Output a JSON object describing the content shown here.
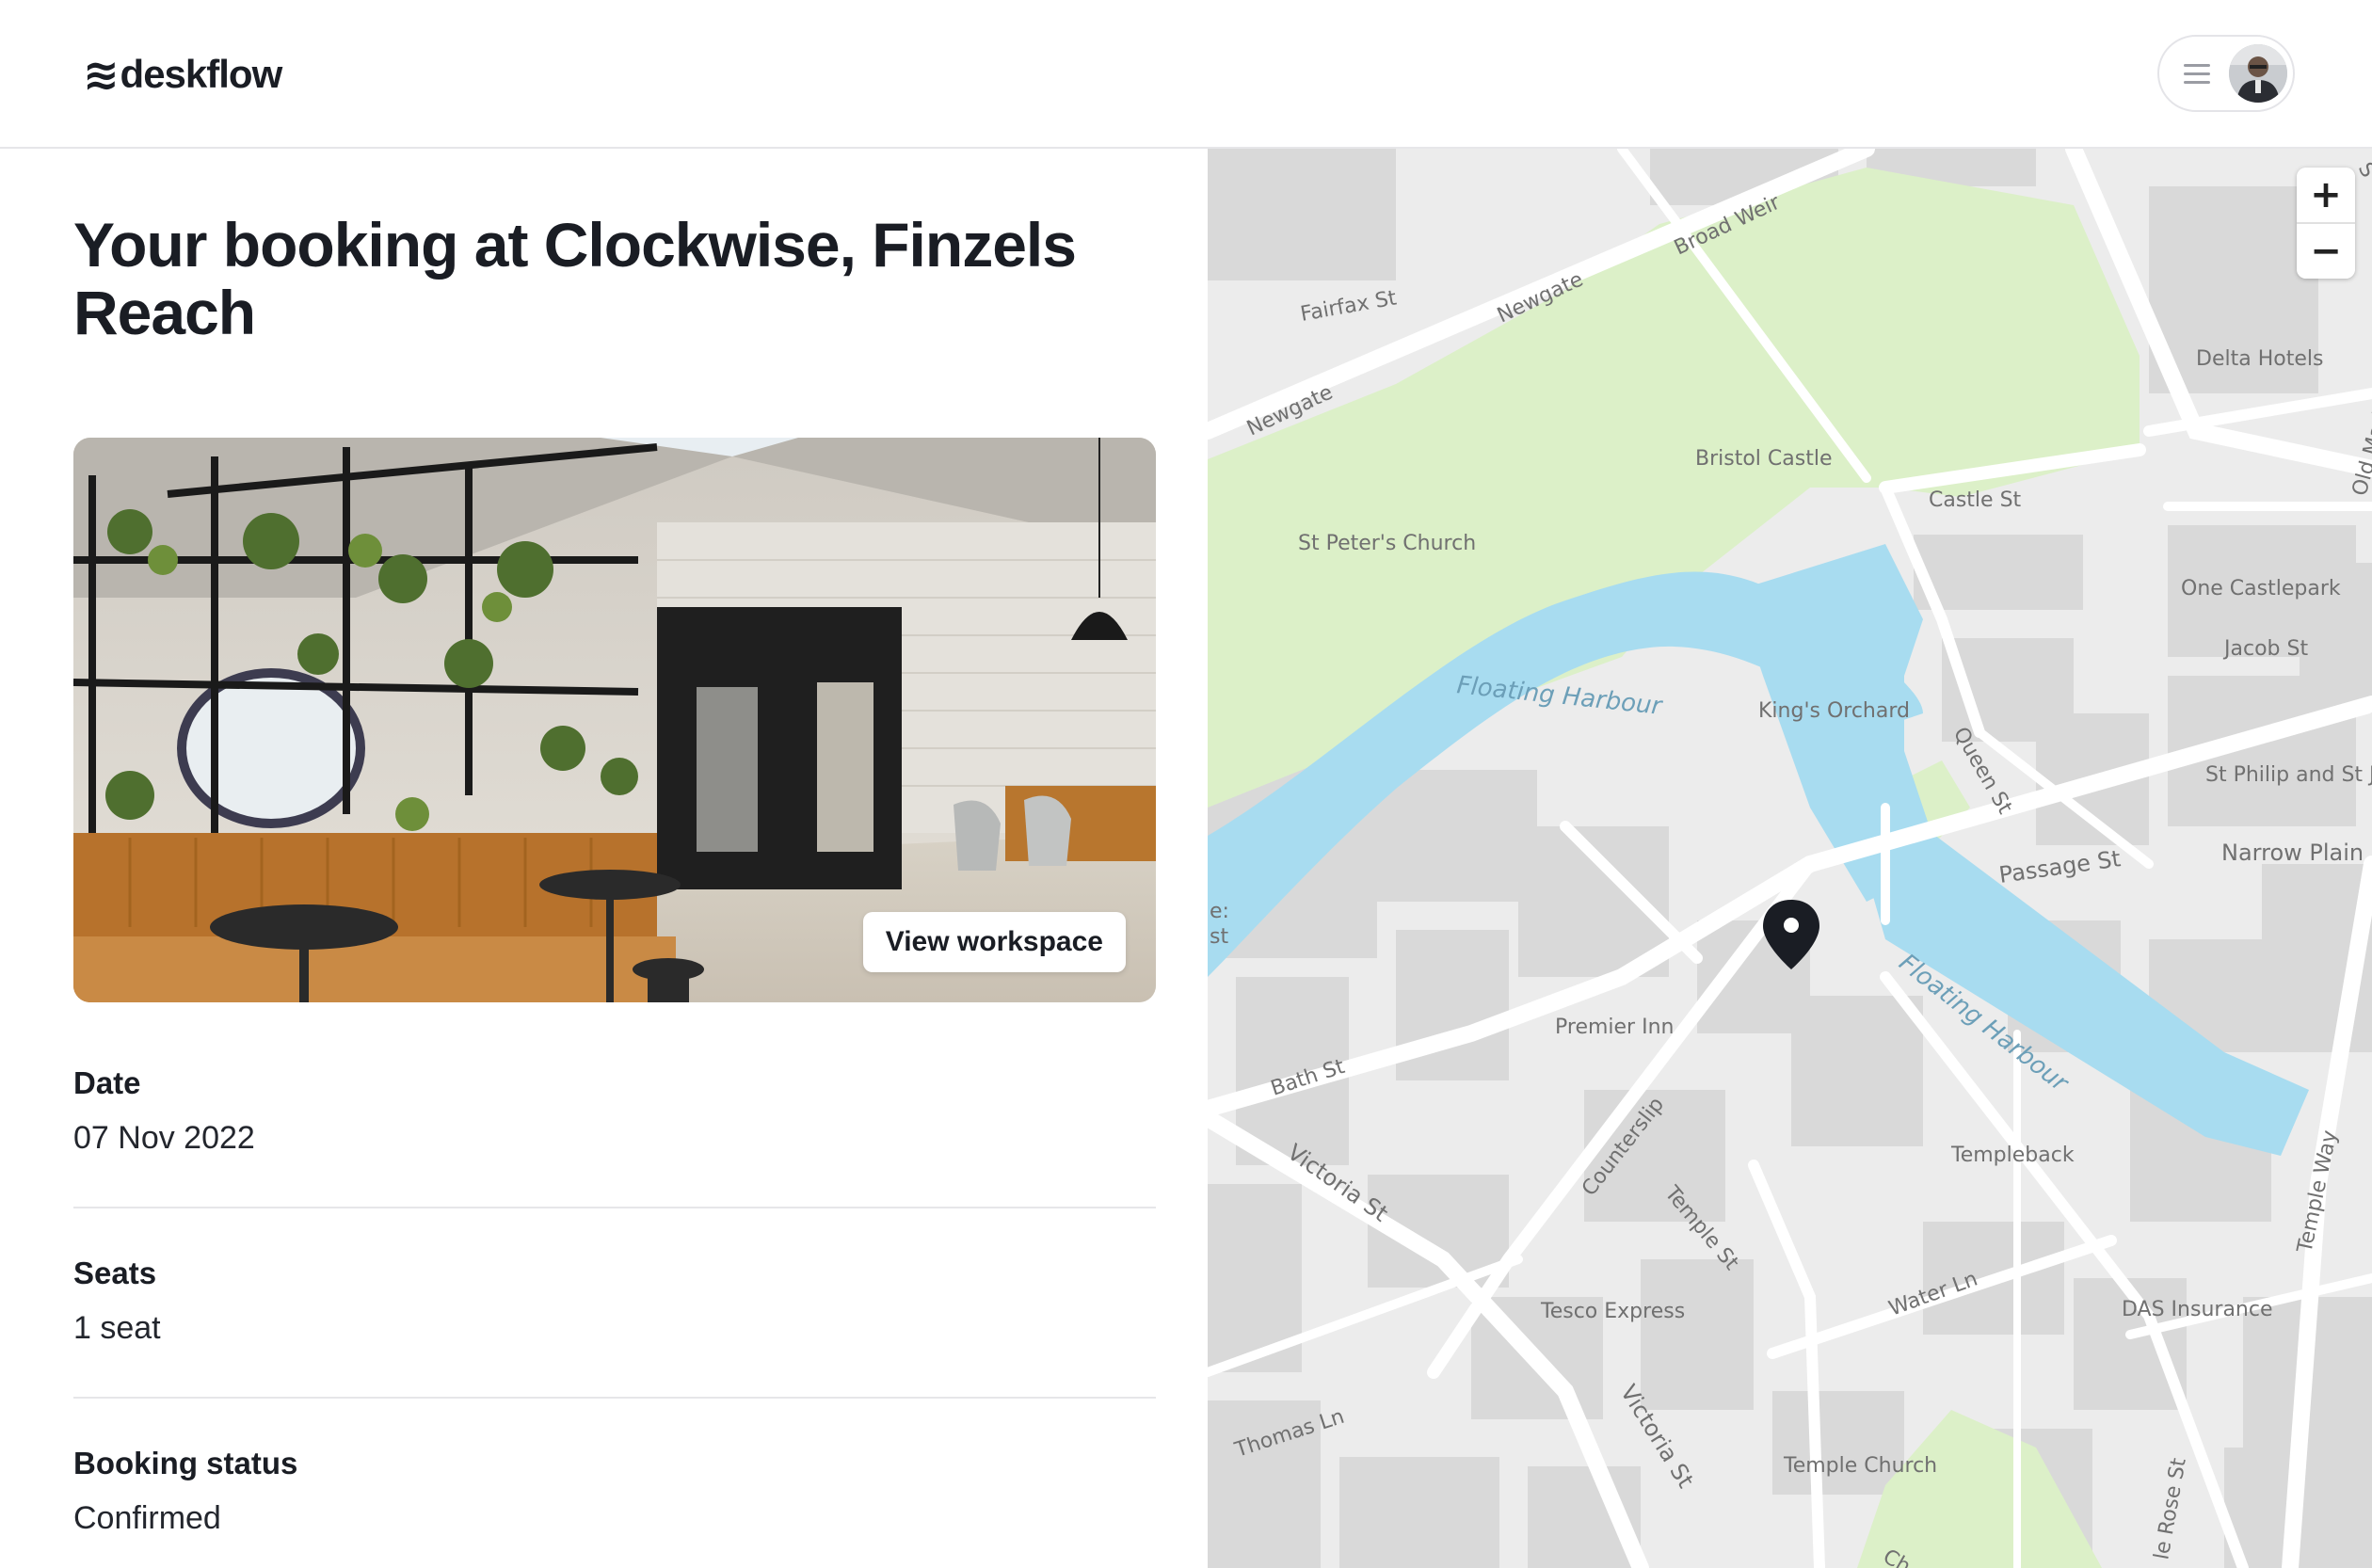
{
  "header": {
    "brand_mark": "≋",
    "brand_name": "deskflow",
    "icons": {
      "menu": "menu-icon",
      "avatar": "user-avatar"
    }
  },
  "booking": {
    "title": "Your booking at Clockwise, Finzels Reach",
    "view_workspace_label": "View workspace",
    "fields": [
      {
        "label": "Date",
        "value": "07 Nov 2022"
      },
      {
        "label": "Seats",
        "value": "1 seat"
      },
      {
        "label": "Booking status",
        "value": "Confirmed"
      }
    ]
  },
  "map": {
    "zoom_in_label": "+",
    "zoom_out_label": "−",
    "colors": {
      "water": "#a8dcf0",
      "park": "#dcf0c8",
      "road": "#ffffff",
      "building": "#d9d9d9",
      "background": "#ececec",
      "pin": "#1a1d24"
    },
    "labels": {
      "broad_weir": "Broad Weir",
      "fairfax_st": "Fairfax St",
      "newgate_1": "Newgate",
      "newgate_2": "Newgate",
      "bristol_castle": "Bristol Castle",
      "st_peters": "St Peter's Church",
      "castle_st": "Castle St",
      "delta_hotels": "Delta Hotels",
      "one_castlepark": "One Castlepark",
      "jacob_st": "Jacob St",
      "floating_harbour_1": "Floating Harbour",
      "kings_orchard": "King's Orchard",
      "queen_st": "Queen St",
      "st_philip": "St Philip and St J",
      "narrow_plain": "Narrow Plain",
      "passage_st": "Passage St",
      "floating_harbour_2": "Floating Harbour",
      "premier_inn": "Premier Inn",
      "bath_st": "Bath St",
      "counterslip": "Counterslip",
      "victoria_st_1": "Victoria St",
      "temple_st": "Temple St",
      "templeback": "Templeback",
      "temple_way": "Temple Way",
      "water_ln": "Water Ln",
      "das_insurance": "DAS Insurance",
      "tesco": "Tesco Express",
      "victoria_st_2": "Victoria St",
      "thomas_ln": "Thomas Ln",
      "temple_church": "Temple Church",
      "rose_st": "le Rose St",
      "old_market": "Old Mark",
      "edge_left_1": "e:",
      "edge_left_2": "st",
      "edge_ch": "Ch",
      "edge_s": "S"
    }
  }
}
